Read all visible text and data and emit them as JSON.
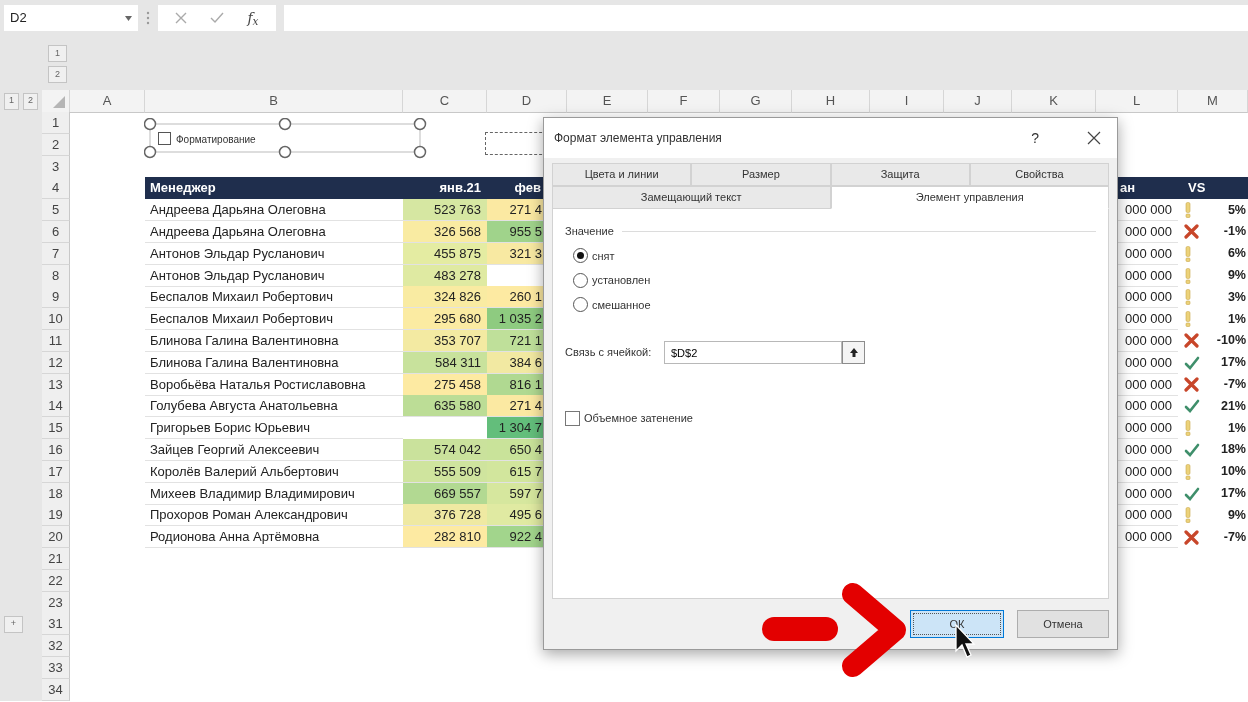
{
  "formula_bar": {
    "name_box": "D2",
    "fx_label": "f$_{x}$"
  },
  "outline": {
    "column_levels": [
      "1",
      "2"
    ],
    "row_levels": [
      "1",
      "2"
    ]
  },
  "columns": [
    "A",
    "B",
    "C",
    "D",
    "E",
    "F",
    "G",
    "H",
    "I",
    "J",
    "K",
    "L",
    "M"
  ],
  "sheet_rows": [
    {
      "number": "1",
      "kind": "blank"
    },
    {
      "number": "2",
      "kind": "blank"
    },
    {
      "number": "3",
      "kind": "blank"
    },
    {
      "number": "4",
      "kind": "table-header"
    },
    {
      "number": "5",
      "kind": "table-row"
    },
    {
      "number": "6",
      "kind": "table-row"
    },
    {
      "number": "7",
      "kind": "table-row"
    },
    {
      "number": "8",
      "kind": "table-row"
    },
    {
      "number": "9",
      "kind": "table-row"
    },
    {
      "number": "10",
      "kind": "table-row"
    },
    {
      "number": "11",
      "kind": "table-row"
    },
    {
      "number": "12",
      "kind": "table-row"
    },
    {
      "number": "13",
      "kind": "table-row"
    },
    {
      "number": "14",
      "kind": "table-row"
    },
    {
      "number": "15",
      "kind": "table-row"
    },
    {
      "number": "16",
      "kind": "table-row"
    },
    {
      "number": "17",
      "kind": "table-row"
    },
    {
      "number": "18",
      "kind": "table-row"
    },
    {
      "number": "19",
      "kind": "table-row"
    },
    {
      "number": "20",
      "kind": "table-row"
    },
    {
      "number": "21",
      "kind": "blank"
    },
    {
      "number": "22",
      "kind": "blank"
    },
    {
      "number": "23",
      "kind": "blank"
    },
    {
      "number": "31",
      "kind": "blank",
      "group_button": "+"
    },
    {
      "number": "32",
      "kind": "blank"
    },
    {
      "number": "33",
      "kind": "blank"
    },
    {
      "number": "34",
      "kind": "blank"
    }
  ],
  "form_checkbox": {
    "label": "Форматирование",
    "checked": false,
    "selected": true
  },
  "table": {
    "header": {
      "manager": "Менеджер",
      "jan": "янв.21",
      "feb": "фев",
      "column_l": "ан",
      "vs": "VS"
    },
    "rows": [
      {
        "manager": "Андреева Дарьяна Олеговна",
        "jan": {
          "text": "523 763",
          "color": "#d6e7a2"
        },
        "feb": {
          "text": "271 4",
          "color": "#fbe9a2"
        },
        "column_l": "000 000",
        "vs": {
          "kind": "warn",
          "text": "5%"
        }
      },
      {
        "manager": "Андреева Дарьяна Олеговна",
        "jan": {
          "text": "326 568",
          "color": "#f9eba2"
        },
        "feb": {
          "text": "955 5",
          "color": "#a0d38b"
        },
        "column_l": "000 000",
        "vs": {
          "kind": "cross",
          "text": "-1%"
        }
      },
      {
        "manager": "Антонов Эльдар Русланович",
        "jan": {
          "text": "455 875",
          "color": "#e4eca2"
        },
        "feb": {
          "text": "321 3",
          "color": "#f8e9a2"
        },
        "column_l": "000 000",
        "vs": {
          "kind": "warn",
          "text": "6%"
        }
      },
      {
        "manager": "Антонов Эльдар Русланович",
        "jan": {
          "text": "483 278",
          "color": "#dfeaa2"
        },
        "feb": null,
        "column_l": "000 000",
        "vs": {
          "kind": "warn",
          "text": "9%"
        }
      },
      {
        "manager": "Беспалов Михаил Робертович",
        "jan": {
          "text": "324 826",
          "color": "#f9eba2"
        },
        "feb": {
          "text": "260 1",
          "color": "#fdeaa2"
        },
        "column_l": "000 000",
        "vs": {
          "kind": "warn",
          "text": "3%"
        }
      },
      {
        "manager": "Беспалов Михаил Робертович",
        "jan": {
          "text": "295 680",
          "color": "#fbeba2"
        },
        "feb": {
          "text": "1 035 2",
          "color": "#8ecb80"
        },
        "column_l": "000 000",
        "vs": {
          "kind": "warn",
          "text": "1%"
        }
      },
      {
        "manager": "Блинова Галина Валентиновна",
        "jan": {
          "text": "353 707",
          "color": "#f3eaa2"
        },
        "feb": {
          "text": "721 1",
          "color": "#bfe09a"
        },
        "column_l": "000 000",
        "vs": {
          "kind": "cross",
          "text": "-10%"
        }
      },
      {
        "manager": "Блинова Галина Валентиновна",
        "jan": {
          "text": "584 311",
          "color": "#c8e29c"
        },
        "feb": {
          "text": "384 6",
          "color": "#f2e9a2"
        },
        "column_l": "000 000",
        "vs": {
          "kind": "check",
          "text": "17%"
        }
      },
      {
        "manager": "Воробьёва Наталья Ростиславовна",
        "jan": {
          "text": "275 458",
          "color": "#fdeaa2"
        },
        "feb": {
          "text": "816 1",
          "color": "#b0d991"
        },
        "column_l": "000 000",
        "vs": {
          "kind": "cross",
          "text": "-7%"
        }
      },
      {
        "manager": "Голубева Августа Анатольевна",
        "jan": {
          "text": "635 580",
          "color": "#bcdd96"
        },
        "feb": {
          "text": "271 4",
          "color": "#fbe9a2"
        },
        "column_l": "000 000",
        "vs": {
          "kind": "check",
          "text": "21%"
        }
      },
      {
        "manager": "Григорьев Борис Юрьевич",
        "jan": null,
        "feb": {
          "text": "1 304 7",
          "color": "#63be7b"
        },
        "column_l": "000 000",
        "vs": {
          "kind": "warn",
          "text": "1%"
        }
      },
      {
        "manager": "Зайцев Георгий Алексеевич",
        "jan": {
          "text": "574 042",
          "color": "#cae29c"
        },
        "feb": {
          "text": "650 4",
          "color": "#c9e39a"
        },
        "column_l": "000 000",
        "vs": {
          "kind": "check",
          "text": "18%"
        }
      },
      {
        "manager": "Королёв Валерий Альбертович",
        "jan": {
          "text": "555 509",
          "color": "#cfe49e"
        },
        "feb": {
          "text": "615 7",
          "color": "#d2e69d"
        },
        "column_l": "000 000",
        "vs": {
          "kind": "warn",
          "text": "10%"
        }
      },
      {
        "manager": "Михеев Владимир Владимирович",
        "jan": {
          "text": "669 557",
          "color": "#b2d992"
        },
        "feb": {
          "text": "597 7",
          "color": "#d6e79e"
        },
        "column_l": "000 000",
        "vs": {
          "kind": "check",
          "text": "17%"
        }
      },
      {
        "manager": "Прохоров Роман Александрович",
        "jan": {
          "text": "376 728",
          "color": "#efe9a2"
        },
        "feb": {
          "text": "495 6",
          "color": "#e0eaa2"
        },
        "column_l": "000 000",
        "vs": {
          "kind": "warn",
          "text": "9%"
        }
      },
      {
        "manager": "Родионова Анна Артёмовна",
        "jan": {
          "text": "282 810",
          "color": "#fdeaa2"
        },
        "feb": {
          "text": "922 4",
          "color": "#a2d58c"
        },
        "column_l": "000 000",
        "vs": {
          "kind": "cross",
          "text": "-7%"
        }
      }
    ]
  },
  "dialog": {
    "title": "Формат элемента управления",
    "help": "?",
    "tab_rows": [
      [
        {
          "label": "Цвета и линии",
          "selected": false
        },
        {
          "label": "Размер",
          "selected": false
        },
        {
          "label": "Защита",
          "selected": false
        },
        {
          "label": "Свойства",
          "selected": false
        }
      ],
      [
        {
          "label": "Замещающий текст",
          "selected": false
        },
        {
          "label": "Элемент управления",
          "selected": true
        }
      ]
    ],
    "value_group": {
      "title": "Значение",
      "options": [
        {
          "label": "снят",
          "selected": true
        },
        {
          "label": "установлен",
          "selected": false
        },
        {
          "label": "смешанное",
          "selected": false
        }
      ]
    },
    "cell_link": {
      "label": "Связь с ячейкой:",
      "value": "$D$2"
    },
    "shading": {
      "label": "Объемное затенение",
      "checked": false
    },
    "buttons": [
      {
        "label": "ОК",
        "focused": true
      },
      {
        "label": "Отмена",
        "focused": false
      }
    ]
  }
}
